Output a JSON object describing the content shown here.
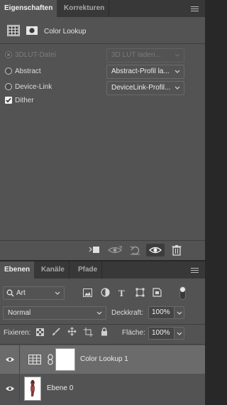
{
  "properties_panel": {
    "tabs": [
      {
        "label": "Eigenschaften",
        "active": true
      },
      {
        "label": "Korrekturen",
        "active": false
      }
    ],
    "header": {
      "title": "Color Lookup",
      "icons": [
        "adjustment-grid-icon",
        "layer-mask-icon"
      ]
    },
    "options": [
      {
        "label": "3DLUT-Datei",
        "type": "radio",
        "selected": true,
        "disabled": true,
        "dropdown": "3D LUT laden..."
      },
      {
        "label": "Abstract",
        "type": "radio",
        "selected": false,
        "disabled": false,
        "dropdown": "Abstract-Profil la..."
      },
      {
        "label": "Device-Link",
        "type": "radio",
        "selected": false,
        "disabled": false,
        "dropdown": "DeviceLink-Profil..."
      },
      {
        "label": "Dither",
        "type": "checkbox",
        "checked": true
      }
    ],
    "footer_buttons": [
      "clip-to-layer-icon",
      "view-previous-state-icon",
      "reset-icon",
      "visibility-eye-icon",
      "trash-icon"
    ]
  },
  "layers_panel": {
    "tabs": [
      {
        "label": "Ebenen",
        "active": true
      },
      {
        "label": "Kanäle",
        "active": false
      },
      {
        "label": "Pfade",
        "active": false
      }
    ],
    "filter": {
      "value": "Art"
    },
    "filter_icons": [
      "filter-pixel-icon",
      "filter-adjustment-icon",
      "filter-type-icon",
      "filter-shape-icon",
      "filter-smart-object-icon"
    ],
    "blend_mode": "Normal",
    "opacity_label": "Deckkraft:",
    "opacity_value": "100%",
    "lock_label": "Fixieren:",
    "lock_icons": [
      "lock-transparent-icon",
      "lock-image-icon",
      "lock-position-icon",
      "lock-artboard-icon",
      "lock-all-icon"
    ],
    "fill_label": "Fläche:",
    "fill_value": "100%",
    "layers": [
      {
        "name": "Color Lookup 1",
        "visible": true,
        "selected": true,
        "kind": "adjustment"
      },
      {
        "name": "Ebene 0",
        "visible": true,
        "selected": false,
        "kind": "pixel"
      }
    ]
  },
  "colors": {
    "panel": "#535353",
    "tabbar": "#383838",
    "selected_layer": "#6b6b6b",
    "background": "#282828"
  }
}
